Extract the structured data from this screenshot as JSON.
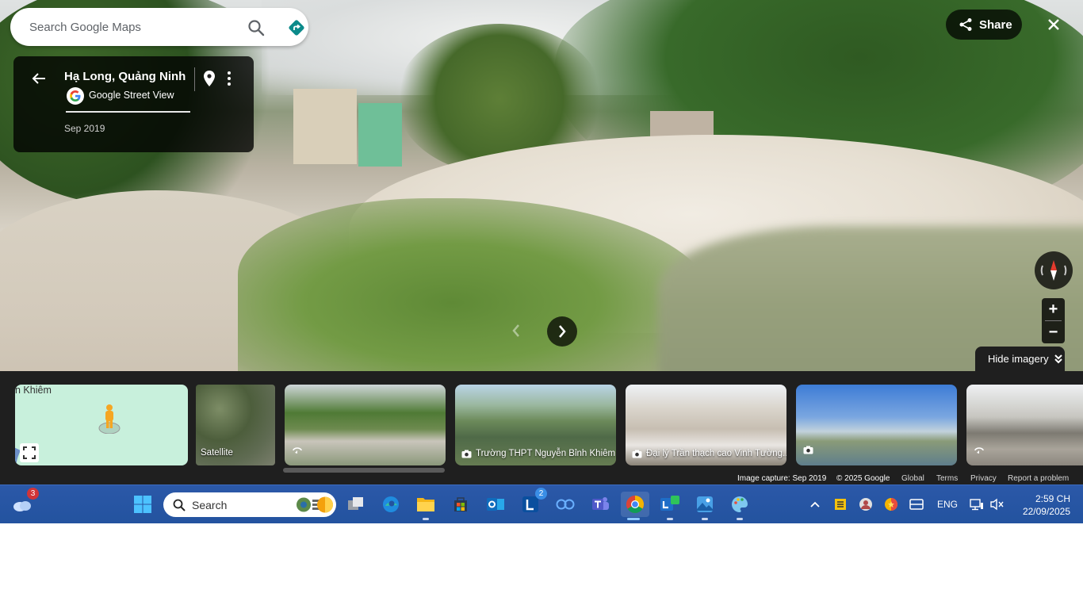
{
  "search": {
    "placeholder": "Search Google Maps"
  },
  "info_card": {
    "title": "Hạ Long, Quảng Ninh",
    "source": "Google Street View",
    "date": "Sep 2019"
  },
  "actions": {
    "share_label": "Share"
  },
  "zoom": {
    "in_label": "+",
    "out_label": "−"
  },
  "hide_imagery_label": "Hide imagery",
  "strip": {
    "minimap_label": "n Khiêm",
    "satellite_label": "Satellite",
    "thumbs": [
      {
        "label": "",
        "icon": "360-icon"
      },
      {
        "label": "Trường THPT Nguyễn Bỉnh Khiêm",
        "icon": "camera-icon"
      },
      {
        "label": "Đại lý Trần thạch cao Vinh Tường...",
        "icon": "camera-icon"
      },
      {
        "label": "",
        "icon": "camera-icon"
      },
      {
        "label": "",
        "icon": "360-icon"
      }
    ]
  },
  "attribution": {
    "capture": "Image capture: Sep 2019",
    "copyright": "© 2025 Google",
    "links": [
      "Global",
      "Terms",
      "Privacy",
      "Report a problem"
    ]
  },
  "taskbar": {
    "weather_badge": "3",
    "search_placeholder": "Search",
    "lync_badge": "2",
    "language": "ENG",
    "time": "2:59 CH",
    "date": "22/09/2025"
  },
  "colors": {
    "accent_blue": "#1a73e8",
    "directions_teal": "#0b8a8a",
    "taskbar": "#23539f"
  }
}
